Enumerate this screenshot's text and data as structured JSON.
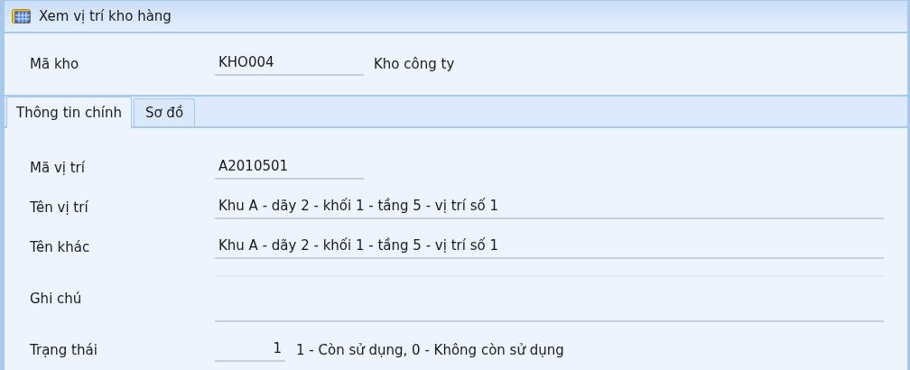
{
  "window": {
    "title": "Xem vị trí kho hàng"
  },
  "warehouse": {
    "label": "Mã kho",
    "code": "KHO004",
    "name": "Kho công ty"
  },
  "tabs": [
    {
      "label": "Thông tin chính",
      "selected": true
    },
    {
      "label": "Sơ đồ",
      "selected": false
    }
  ],
  "fields": [
    {
      "kind": "short",
      "label": "Mã vị trí",
      "value": "A2010501"
    },
    {
      "kind": "wide",
      "label": "Tên vị trí",
      "value": "Khu A - dãy 2 - khối 1  - tầng 5 - vị trí số 1"
    },
    {
      "kind": "wide",
      "label": "Tên khác",
      "value": "Khu A - dãy 2 - khối 1  - tầng 5 - vị trí số 1"
    },
    {
      "kind": "area",
      "label": "Ghi chú"
    },
    {
      "kind": "number",
      "label": "Trạng thái",
      "value": "1",
      "hint": "1 - Còn sử dụng, 0 - Không còn sử dụng"
    }
  ]
}
